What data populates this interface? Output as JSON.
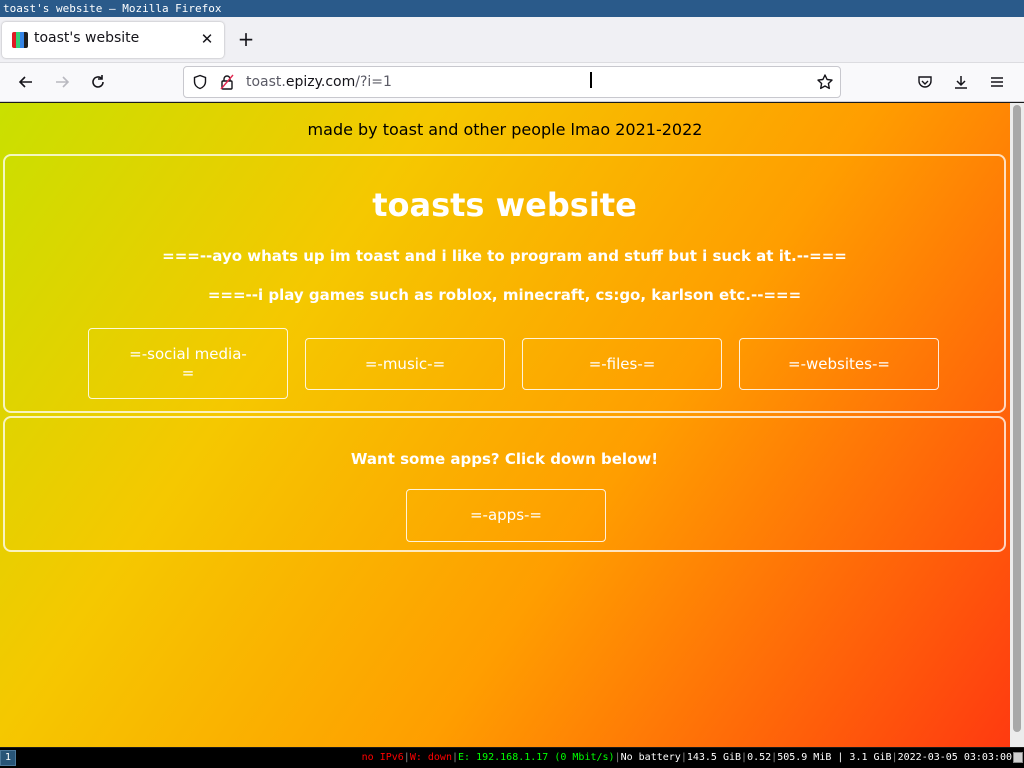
{
  "window": {
    "title": "toast's website — Mozilla Firefox"
  },
  "browser": {
    "tab_title": "toast's website",
    "url_prefix": "toast.",
    "url_host": "epizy.com",
    "url_suffix": "/?i=1"
  },
  "page": {
    "credit": "made by toast and other people lmao 2021-2022",
    "title": "toasts website",
    "intro_1": "===--ayo whats up im toast and i like to program and stuff but i suck at it.--===",
    "intro_2": "===--i play games such as roblox, minecraft, cs:go, karlson etc.--===",
    "buttons": {
      "social": "=-social media-=",
      "music": "=-music-=",
      "files": "=-files-=",
      "websites": "=-websites-="
    },
    "apps_heading": "Want some apps? Click down below!",
    "apps_button": "=-apps-="
  },
  "statusbar": {
    "workspace": "1",
    "ipv6": "no IPv6",
    "wifi": "W: down",
    "ethernet": "E: 192.168.1.17 (0 Mbit/s)",
    "battery": "No battery",
    "disk": "143.5 GiB",
    "load": "0.52",
    "memory": "505.9 MiB | 3.1 GiB",
    "datetime": "2022-03-05 03:03:00"
  },
  "colors": {
    "gradient_start": "#c9e000",
    "gradient_end": "#ff3a10",
    "wm_title_bg": "#2a5a8a"
  }
}
